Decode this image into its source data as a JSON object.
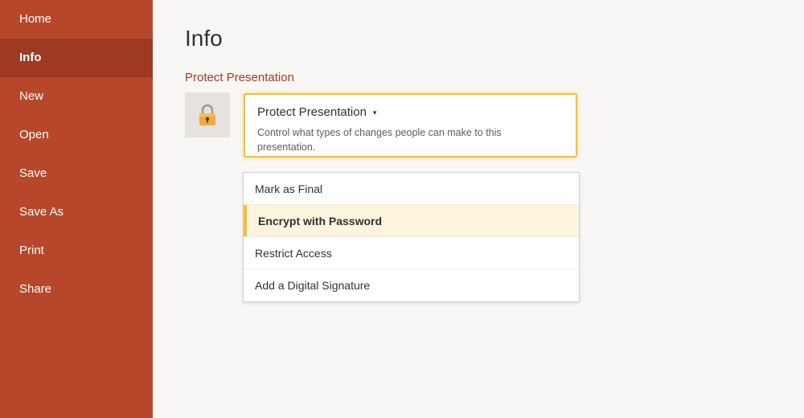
{
  "sidebar": {
    "items": [
      {
        "label": "Home"
      },
      {
        "label": "Info"
      },
      {
        "label": "New"
      },
      {
        "label": "Open"
      },
      {
        "label": "Save"
      },
      {
        "label": "Save As"
      },
      {
        "label": "Print"
      },
      {
        "label": "Share"
      }
    ],
    "active_index": 1,
    "bg_color": "#b7472a",
    "active_color": "#9e3a22"
  },
  "main": {
    "title": "Info",
    "section_title": "Protect Presentation",
    "protect_card": {
      "title": "Protect Presentation",
      "caret": "▾",
      "description": "Control what types of changes people can make to this presentation.",
      "icon": "lock-icon",
      "accent_color": "#f2c12e"
    },
    "dropdown": {
      "items": [
        {
          "label": "Mark as Final"
        },
        {
          "label": "Encrypt with Password"
        },
        {
          "label": "Restrict Access"
        },
        {
          "label": "Add a Digital Signature"
        }
      ],
      "highlighted_index": 1
    }
  }
}
